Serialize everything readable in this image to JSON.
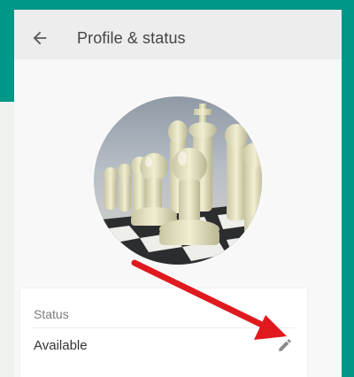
{
  "header": {
    "title": "Profile & status",
    "back_icon": "arrow-back-icon"
  },
  "avatar": {
    "description_icon": "profile-photo"
  },
  "status": {
    "label": "Status",
    "value": "Available",
    "edit_icon": "pencil-icon"
  },
  "colors": {
    "accent": "#009688",
    "panel_bg": "#f8f8f8",
    "header_bg": "#ededed",
    "annotation_arrow": "#e0191e"
  }
}
